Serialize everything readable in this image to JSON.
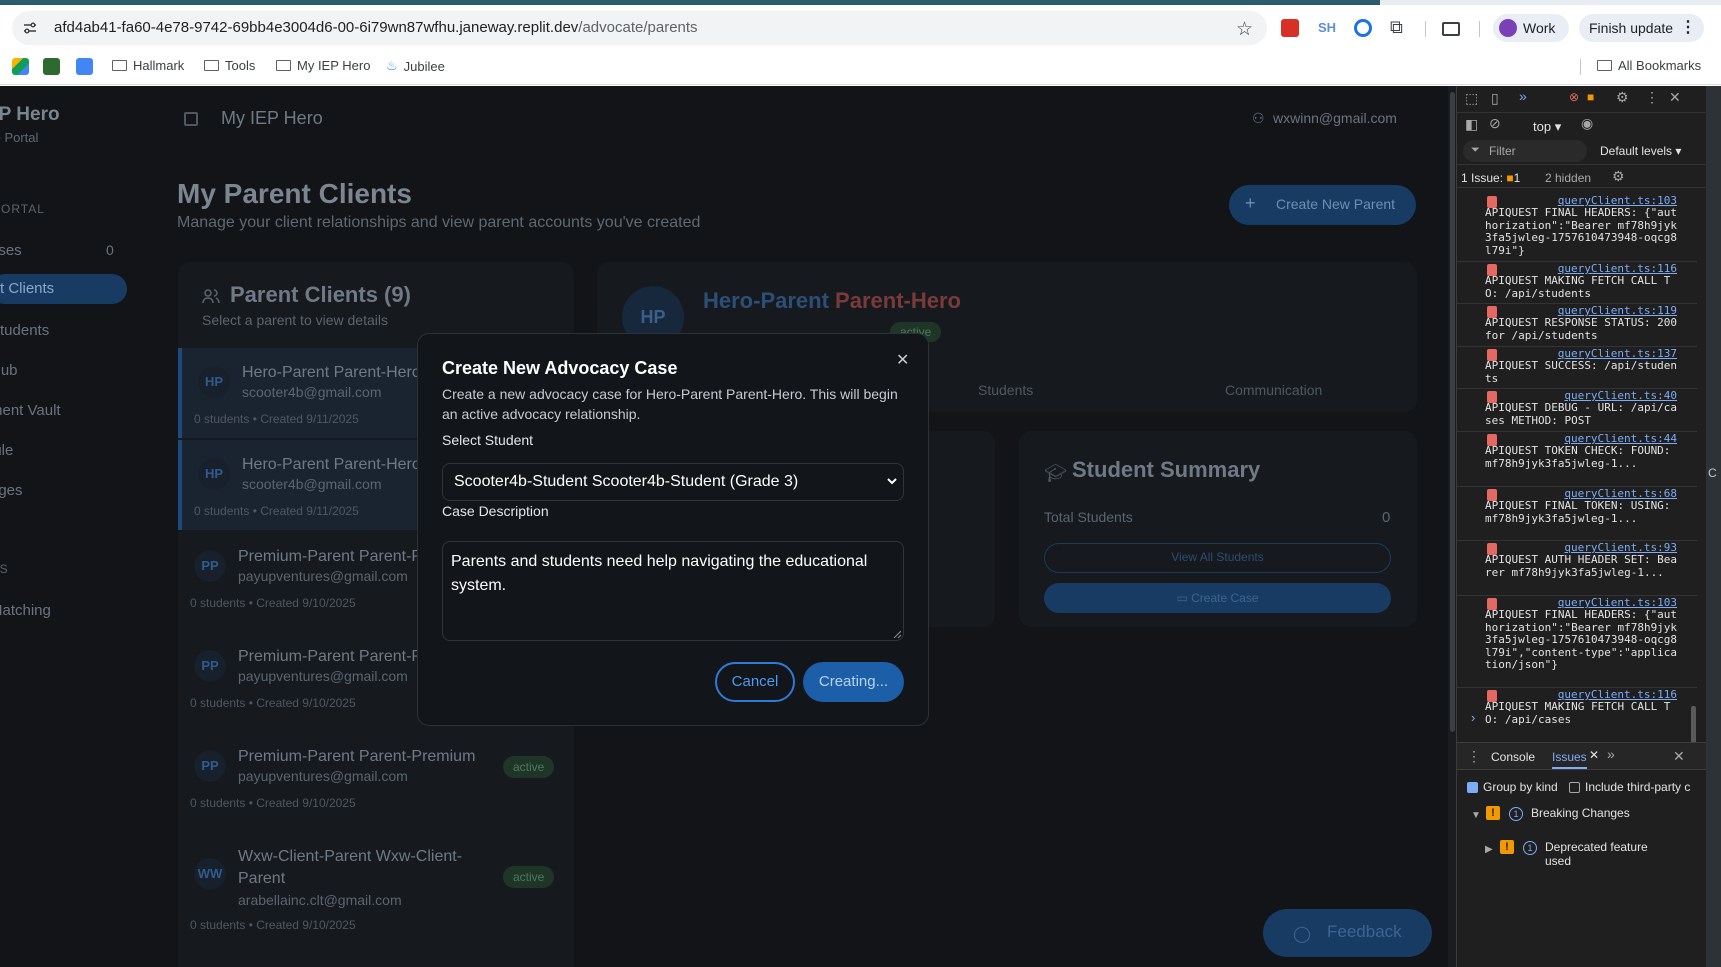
{
  "browser": {
    "url_host": "afd4ab41-fa60-4e78-9742-69bb4e3004d6-00-6i79wn87wfhu.janeway.replit.dev",
    "url_path": "/advocate/parents",
    "profile_label": "Work",
    "update_label": "Finish update",
    "ext_sh_label": "SH",
    "bookmarks": [
      "Hallmark",
      "Tools",
      "My IEP Hero",
      "Jubilee"
    ],
    "all_bookmarks": "All Bookmarks"
  },
  "sidebar": {
    "app_title": "EP Hero",
    "app_sub": "te Portal",
    "section_portal": "PORTAL",
    "section_ls": "LS",
    "items": [
      "ases",
      "t Clients",
      "Students",
      "Hub",
      "ment Vault",
      "lule",
      "ages",
      "Matching"
    ],
    "cases_count": "0"
  },
  "header": {
    "title": "My IEP Hero",
    "user_email": "wxwinn@gmail.com"
  },
  "page": {
    "title": "My Parent Clients",
    "subtitle": "Manage your client relationships and view parent accounts you've created",
    "create_parent_label": "Create New Parent"
  },
  "clients": {
    "title": "Parent Clients (9)",
    "subtitle": "Select a parent to view details",
    "list": [
      {
        "initials": "HP",
        "name": "Hero-Parent Parent-Hero",
        "email": "scooter4b@gmail.com",
        "meta": "0 students • Created 9/11/2025",
        "badge": ""
      },
      {
        "initials": "HP",
        "name": "Hero-Parent Parent-Hero",
        "email": "scooter4b@gmail.com",
        "meta": "0 students • Created 9/11/2025",
        "badge": ""
      },
      {
        "initials": "PP",
        "name": "Premium-Parent Parent-Premium",
        "email": "payupventures@gmail.com",
        "meta": "0 students • Created 9/10/2025",
        "badge": ""
      },
      {
        "initials": "PP",
        "name": "Premium-Parent Parent-Premium",
        "email": "payupventures@gmail.com",
        "meta": "0 students • Created 9/10/2025",
        "badge": ""
      },
      {
        "initials": "PP",
        "name": "Premium-Parent Parent-Premium",
        "email": "payupventures@gmail.com",
        "meta": "0 students • Created 9/10/2025",
        "badge": "active"
      },
      {
        "initials": "WW",
        "name": "Wxw-Client-Parent Wxw-Client-Parent",
        "email": "arabellainc.clt@gmail.com",
        "meta": "0 students • Created 9/10/2025",
        "badge": "active"
      }
    ]
  },
  "detail": {
    "initials": "HP",
    "name_first": "Hero-Parent",
    "name_last": "Parent-Hero",
    "badge": "active",
    "tabs": [
      "Students",
      "Communication"
    ]
  },
  "summary": {
    "title": "Student Summary",
    "total_label": "Total Students",
    "total_value": "0",
    "view_all_label": "View All Students",
    "create_case_label": "Create Case"
  },
  "feedback_label": "Feedback",
  "modal": {
    "title": "Create New Advocacy Case",
    "description": "Create a new advocacy case for Hero-Parent Parent-Hero. This will begin an active advocacy relationship.",
    "student_label": "Select Student",
    "student_value": "Scooter4b-Student Scooter4b-Student (Grade 3)",
    "case_desc_label": "Case Description",
    "case_desc_value": "Parents and students need help navigating the educational system.",
    "cancel_label": "Cancel",
    "submit_label": "Creating..."
  },
  "devtools": {
    "context": "top",
    "filter_placeholder": "Filter",
    "levels": "Default levels",
    "issues_label": "1 Issue:",
    "issues_count": "1",
    "hidden": "2 hidden",
    "logs": [
      {
        "src": "queryClient.ts:103",
        "text": "APIQUEST FINAL HEADERS: {\"authorization\":\"Bearer mf78h9jyk3fa5jwleg-1757610473948-oqcg8l79i\"}"
      },
      {
        "src": "queryClient.ts:116",
        "text": "APIQUEST MAKING FETCH CALL TO: /api/students"
      },
      {
        "src": "queryClient.ts:119",
        "text": "APIQUEST RESPONSE STATUS: 200 for /api/students"
      },
      {
        "src": "queryClient.ts:137",
        "text": "APIQUEST SUCCESS: /api/students"
      },
      {
        "src": "queryClient.ts:40",
        "text": "APIQUEST DEBUG - URL: /api/cases METHOD: POST"
      },
      {
        "src": "queryClient.ts:44",
        "text": "APIQUEST TOKEN CHECK: FOUND: mf78h9jyk3fa5jwleg-1..."
      },
      {
        "src": "queryClient.ts:68",
        "text": "APIQUEST FINAL TOKEN: USING: mf78h9jyk3fa5jwleg-1..."
      },
      {
        "src": "queryClient.ts:93",
        "text": "APIQUEST AUTH HEADER SET: Bearer mf78h9jyk3fa5jwleg-1..."
      },
      {
        "src": "queryClient.ts:103",
        "text": "APIQUEST FINAL HEADERS: {\"authorization\":\"Bearer mf78h9jyk3fa5jwleg-1757610473948-oqcg8l79i\",\"content-type\":\"application/json\"}"
      },
      {
        "src": "queryClient.ts:116",
        "text": "APIQUEST MAKING FETCH CALL TO: /api/cases"
      }
    ],
    "drawer_tabs": [
      "Console",
      "Issues"
    ],
    "group_by_kind": "Group by kind",
    "include_third_party": "Include third-party c",
    "breaking_changes": "Breaking Changes",
    "breaking_count": "1",
    "deprecated": "Deprecated feature used",
    "deprecated_count": "1"
  },
  "colors": {
    "accent": "#2f7ad6",
    "app_bg": "#121417",
    "modal_bg": "#121519",
    "devtools_bg": "#1f1f1f",
    "error": "#e46962",
    "warning": "#f29900"
  }
}
